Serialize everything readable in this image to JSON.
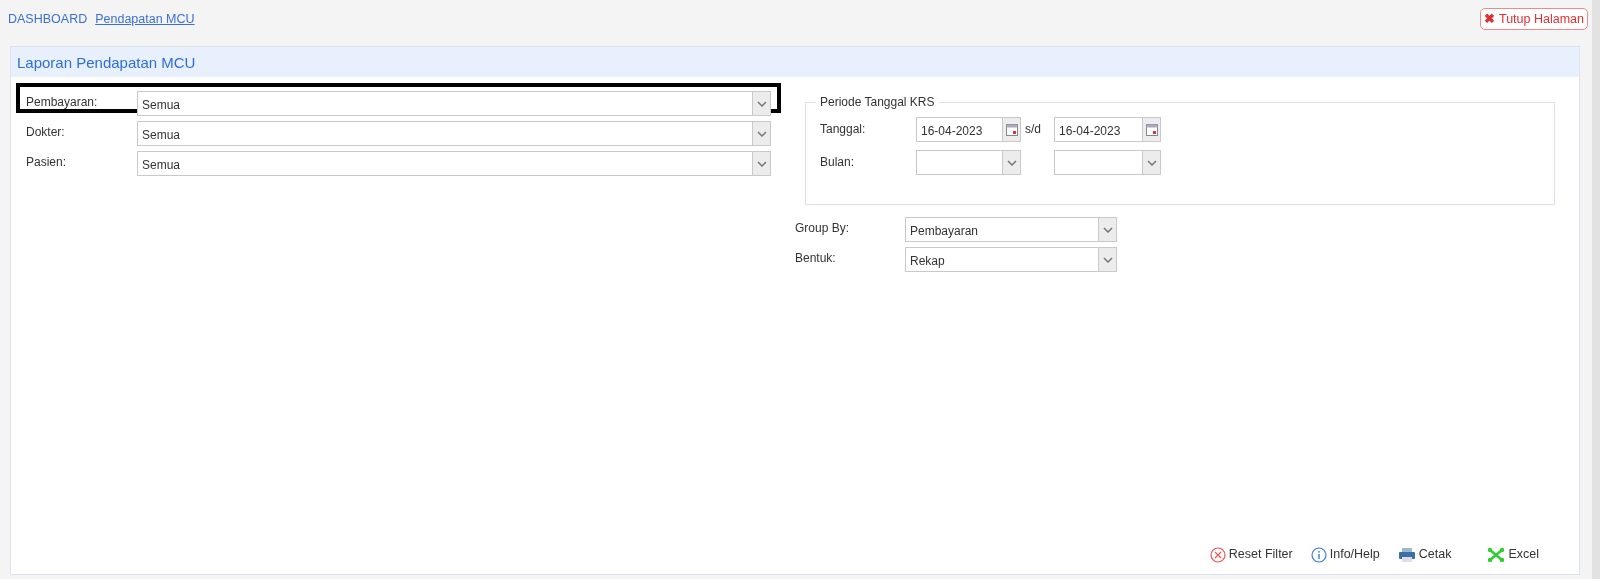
{
  "breadcrumb": [
    {
      "label": "DASHBOARD",
      "selected": false
    },
    {
      "label": "Pendapatan MCU",
      "selected": true
    }
  ],
  "close_button": {
    "icon": "✖",
    "label": "Tutup Halaman"
  },
  "panel": {
    "title": "Laporan Pendapatan MCU"
  },
  "left_fields": [
    {
      "label": "Pembayaran:",
      "value": "Semua",
      "highlighted": true
    },
    {
      "label": "Dokter:",
      "value": "Semua",
      "highlighted": false
    },
    {
      "label": "Pasien:",
      "value": "Semua",
      "highlighted": false
    }
  ],
  "period": {
    "legend": "Periode Tanggal KRS",
    "rows": [
      {
        "label": "Tanggal:",
        "kind": "date",
        "from": "16-04-2023",
        "separator": "s/d",
        "to": "16-04-2023"
      },
      {
        "label": "Bulan:",
        "kind": "select",
        "from": "",
        "to": ""
      }
    ]
  },
  "right_fields": [
    {
      "label": "Group By:",
      "value": "Pembayaran"
    },
    {
      "label": "Bentuk:",
      "value": "Rekap"
    }
  ],
  "actions": [
    {
      "kind": "reset",
      "label": "Reset Filter"
    },
    {
      "kind": "info",
      "label": "Info/Help"
    },
    {
      "kind": "print",
      "label": "Cetak"
    },
    {
      "kind": "excel",
      "label": "Excel"
    }
  ]
}
